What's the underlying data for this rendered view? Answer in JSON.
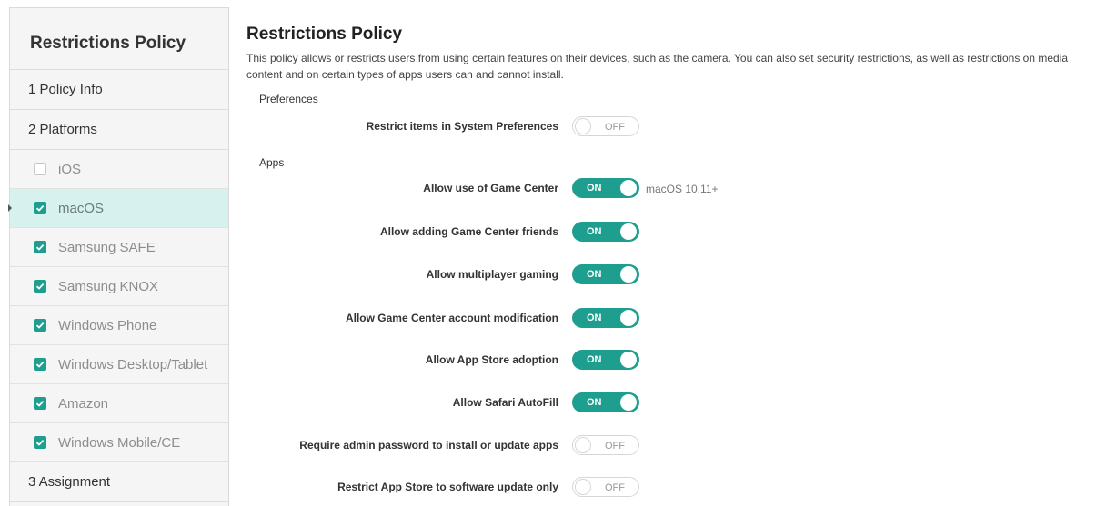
{
  "sidebar": {
    "title": "Restrictions Policy",
    "steps": {
      "policy_info": "1  Policy Info",
      "platforms": "2  Platforms",
      "assignment": "3  Assignment"
    },
    "platforms": [
      {
        "label": "iOS",
        "checked": false
      },
      {
        "label": "macOS",
        "checked": true,
        "active": true
      },
      {
        "label": "Samsung SAFE",
        "checked": true
      },
      {
        "label": "Samsung KNOX",
        "checked": true
      },
      {
        "label": "Windows Phone",
        "checked": true
      },
      {
        "label": "Windows Desktop/Tablet",
        "checked": true
      },
      {
        "label": "Amazon",
        "checked": true
      },
      {
        "label": "Windows Mobile/CE",
        "checked": true
      }
    ]
  },
  "main": {
    "title": "Restrictions Policy",
    "description": "This policy allows or restricts users from using certain features on their devices, such as the camera. You can also set security restrictions, as well as restrictions on media content and on certain types of apps users can and cannot install.",
    "sections": {
      "preferences": "Preferences",
      "apps": "Apps"
    },
    "settings": [
      {
        "label": "Restrict items in System Preferences",
        "state": "OFF"
      },
      {
        "label": "Allow use of Game Center",
        "state": "ON",
        "hint": "macOS 10.11+"
      },
      {
        "label": "Allow adding Game Center friends",
        "state": "ON"
      },
      {
        "label": "Allow multiplayer gaming",
        "state": "ON"
      },
      {
        "label": "Allow Game Center account modification",
        "state": "ON"
      },
      {
        "label": "Allow App Store adoption",
        "state": "ON"
      },
      {
        "label": "Allow Safari AutoFill",
        "state": "ON"
      },
      {
        "label": "Require admin password to install or update apps",
        "state": "OFF"
      },
      {
        "label": "Restrict App Store to software update only",
        "state": "OFF"
      }
    ]
  },
  "colors": {
    "accent": "#1d9e8e",
    "active_row": "#d6f1ee",
    "sidebar_bg": "#f5f5f5"
  }
}
